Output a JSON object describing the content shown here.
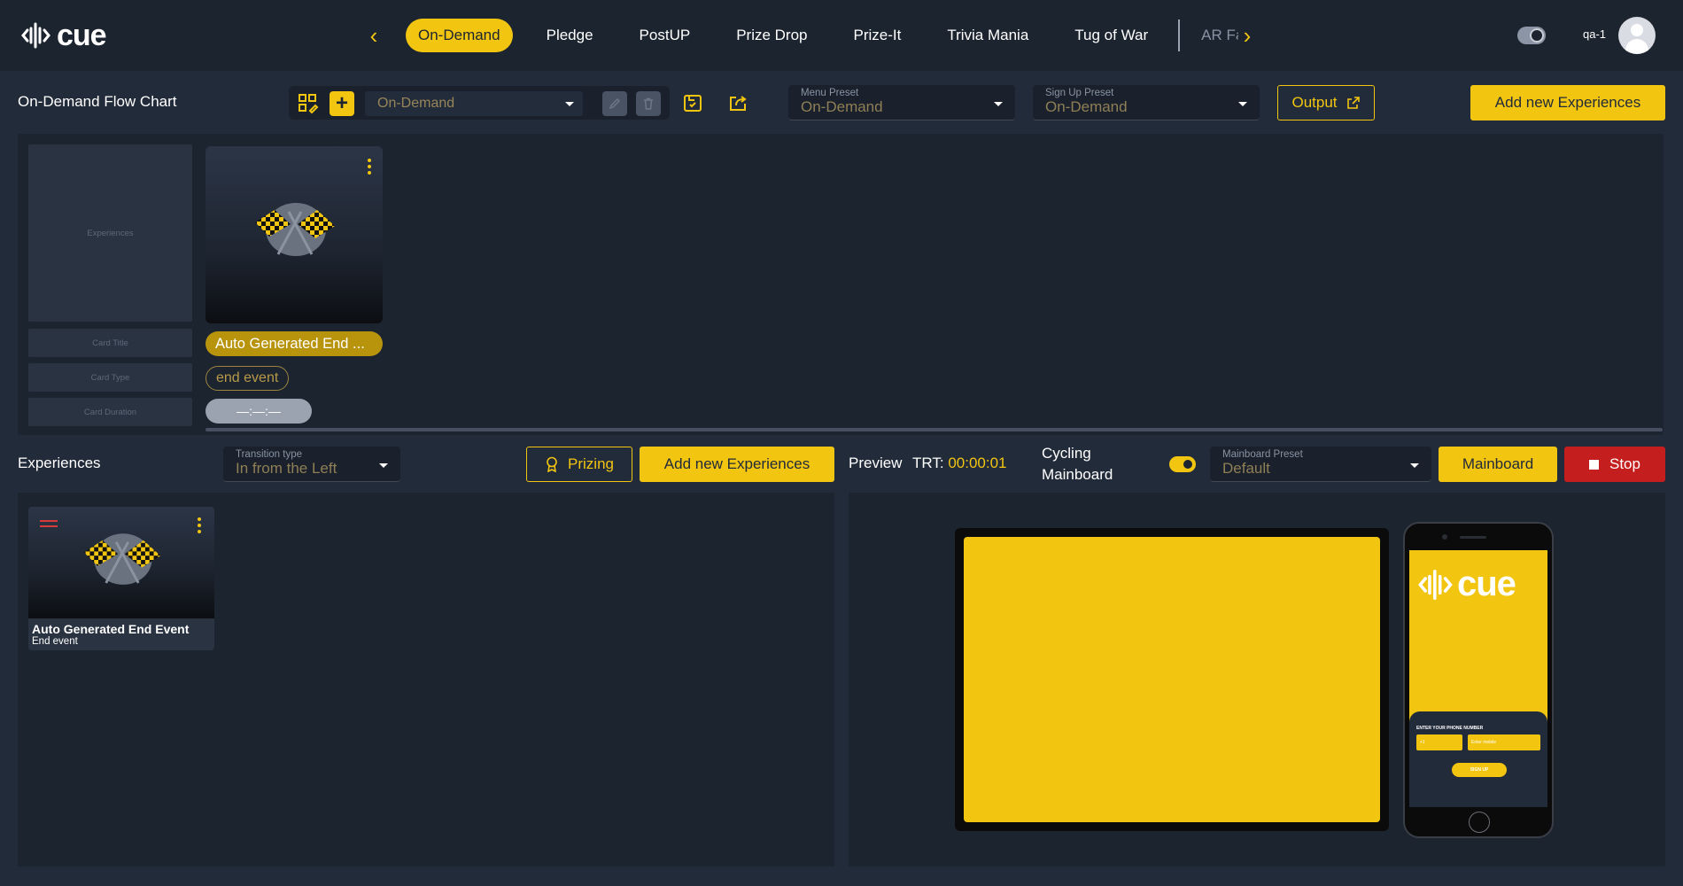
{
  "app": {
    "logo_text": "cue",
    "brand_color": "#f2c511"
  },
  "nav": {
    "tabs": [
      {
        "label": "On-Demand",
        "active": true
      },
      {
        "label": "Pledge"
      },
      {
        "label": "PostUP"
      },
      {
        "label": "Prize Drop"
      },
      {
        "label": "Prize-It"
      },
      {
        "label": "Trivia Mania"
      },
      {
        "label": "Tug of War"
      },
      {
        "label": "AR Fa"
      }
    ],
    "prev_icon": "chevron-left-icon",
    "next_icon": "chevron-right-icon"
  },
  "user": {
    "name": "qa-1"
  },
  "toolbar": {
    "title": "On-Demand Flow Chart",
    "flow_select_value": "On-Demand",
    "menu_preset": {
      "label": "Menu Preset",
      "value": "On-Demand"
    },
    "signup_preset": {
      "label": "Sign Up Preset",
      "value": "On-Demand"
    },
    "output_label": "Output",
    "add_label": "Add new Experiences"
  },
  "flow": {
    "legend": {
      "experiences": "Experiences",
      "card_title": "Card Title",
      "card_type": "Card Type",
      "card_duration": "Card Duration"
    },
    "cards": [
      {
        "title": "Auto Generated End ...",
        "type": "end event",
        "duration": "—:—:—",
        "image_icon": "checkered-flags-icon"
      }
    ]
  },
  "experiences": {
    "title": "Experiences",
    "transition": {
      "label": "Transition type",
      "value": "In from the Left"
    },
    "prizing_label": "Prizing",
    "add_label": "Add new Experiences",
    "items": [
      {
        "title": "Auto Generated End Event",
        "subtitle": "End event"
      }
    ]
  },
  "preview": {
    "label": "Preview",
    "trt_label": "TRT:",
    "trt_value": "00:00:01",
    "cycling_line1": "Cycling",
    "cycling_line2": "Mainboard",
    "cycling_on": true,
    "mainboard_preset": {
      "label": "Mainboard Preset",
      "value": "Default"
    },
    "mainboard_label": "Mainboard",
    "stop_label": "Stop",
    "phone": {
      "logo_text": "cue",
      "form_label": "ENTER YOUR PHONE NUMBER",
      "code_value": "+1",
      "number_placeholder": "Enter mobile",
      "signup_label": "SIGN UP"
    }
  }
}
